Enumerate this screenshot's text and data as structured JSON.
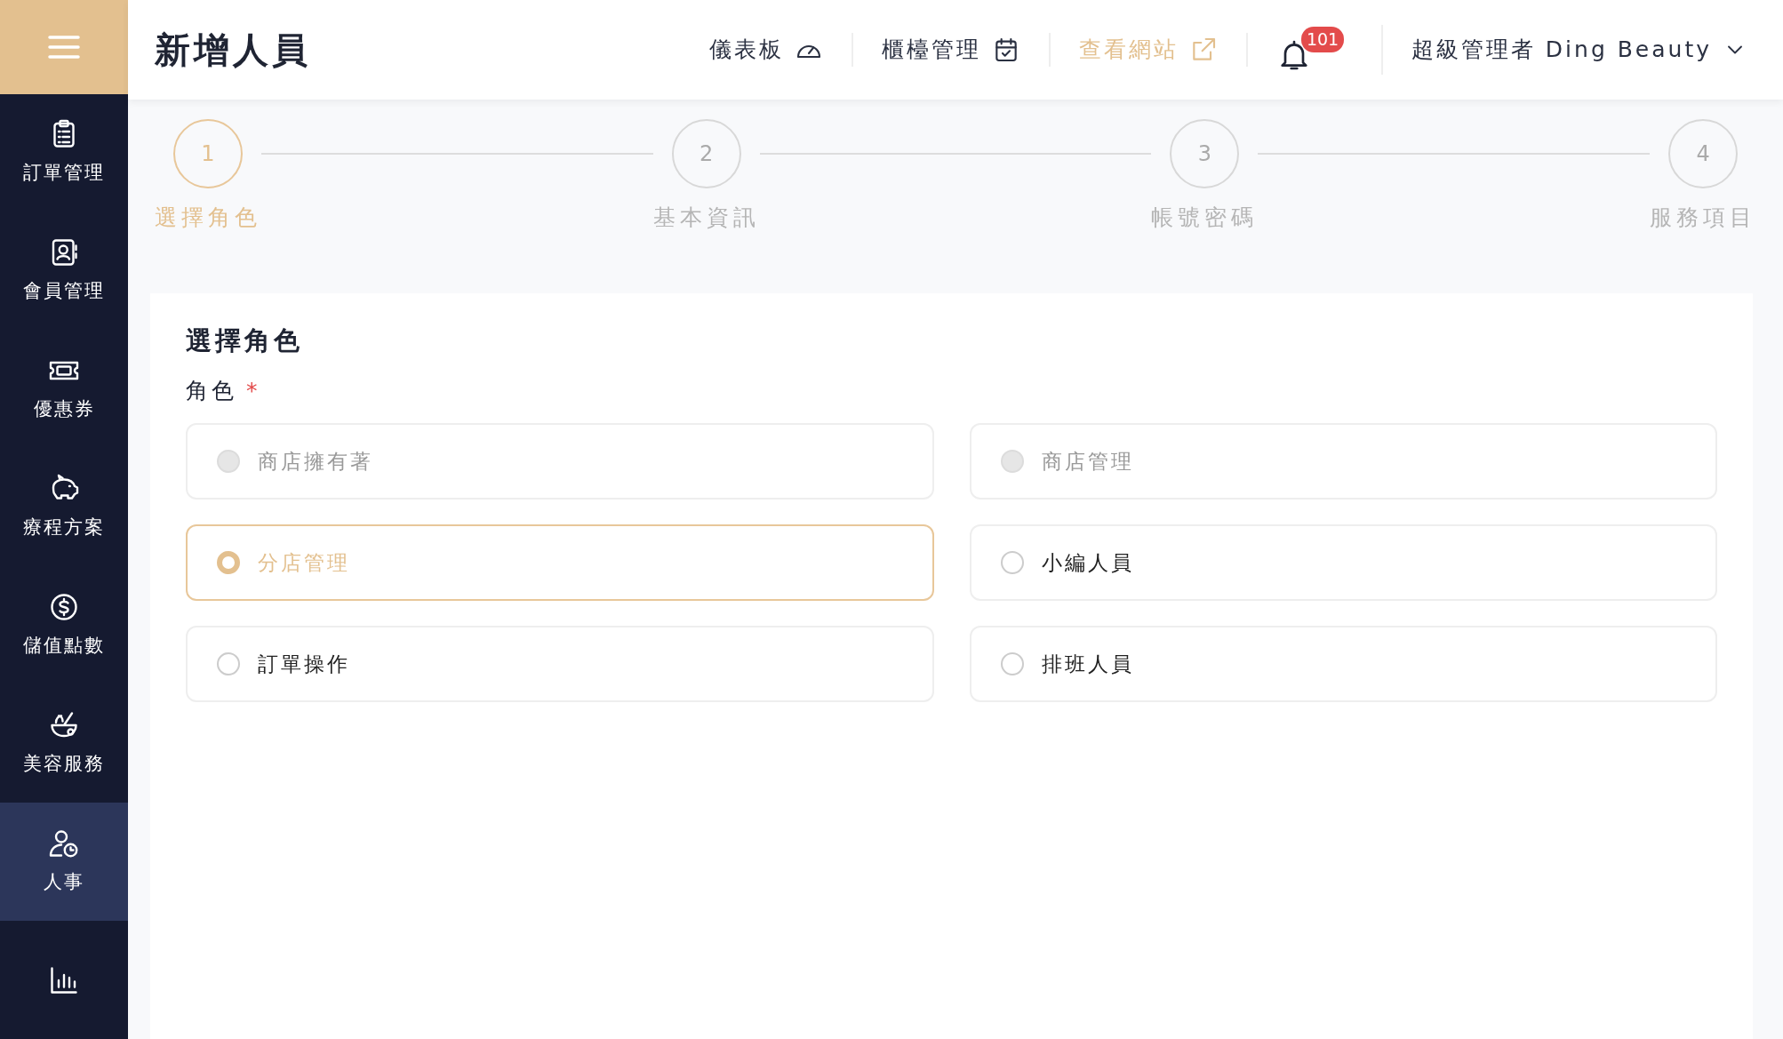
{
  "header": {
    "title": "新增人員",
    "nav": [
      {
        "label": "儀表板",
        "kind": "gauge",
        "highlight": false
      },
      {
        "label": "櫃檯管理",
        "kind": "calendar",
        "highlight": false
      },
      {
        "label": "查看網站",
        "kind": "external",
        "highlight": true
      }
    ],
    "notifications": {
      "count": "101"
    },
    "user": {
      "label": "超級管理者 Ding Beauty"
    }
  },
  "sidebar": {
    "items": [
      {
        "label": "訂單管理",
        "kind": "clipboard",
        "selected": false
      },
      {
        "label": "會員管理",
        "kind": "contact",
        "selected": false
      },
      {
        "label": "優惠券",
        "kind": "ticket",
        "selected": false
      },
      {
        "label": "療程方案",
        "kind": "piggy",
        "selected": false
      },
      {
        "label": "儲值點數",
        "kind": "coin",
        "selected": false
      },
      {
        "label": "美容服務",
        "kind": "bowl",
        "selected": false
      },
      {
        "label": "人事",
        "kind": "person-clock",
        "selected": true
      },
      {
        "kind": "chart",
        "selected": false
      }
    ]
  },
  "steps": [
    {
      "number": "1",
      "label": "選擇角色",
      "selected": true
    },
    {
      "number": "2",
      "label": "基本資訊",
      "selected": false
    },
    {
      "number": "3",
      "label": "帳號密碼",
      "selected": false
    },
    {
      "number": "4",
      "label": "服務項目",
      "selected": false
    }
  ],
  "form": {
    "title": "選擇角色",
    "field_label": "角色",
    "required_mark": "*",
    "options": [
      {
        "label": "商店擁有著",
        "selected": false,
        "disabled": true
      },
      {
        "label": "商店管理",
        "selected": false,
        "disabled": true
      },
      {
        "label": "分店管理",
        "selected": true,
        "disabled": false
      },
      {
        "label": "小編人員",
        "selected": false,
        "disabled": false
      },
      {
        "label": "訂單操作",
        "selected": false,
        "disabled": false
      },
      {
        "label": "排班人員",
        "selected": false,
        "disabled": false
      }
    ]
  }
}
